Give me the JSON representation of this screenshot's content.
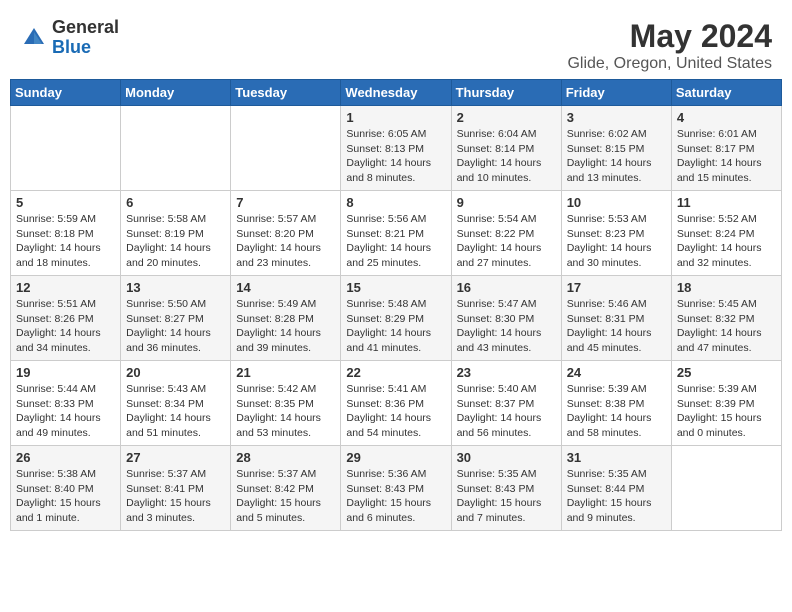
{
  "header": {
    "logo_general": "General",
    "logo_blue": "Blue",
    "month_title": "May 2024",
    "location": "Glide, Oregon, United States"
  },
  "weekdays": [
    "Sunday",
    "Monday",
    "Tuesday",
    "Wednesday",
    "Thursday",
    "Friday",
    "Saturday"
  ],
  "weeks": [
    [
      {
        "day": "",
        "info": ""
      },
      {
        "day": "",
        "info": ""
      },
      {
        "day": "",
        "info": ""
      },
      {
        "day": "1",
        "info": "Sunrise: 6:05 AM\nSunset: 8:13 PM\nDaylight: 14 hours\nand 8 minutes."
      },
      {
        "day": "2",
        "info": "Sunrise: 6:04 AM\nSunset: 8:14 PM\nDaylight: 14 hours\nand 10 minutes."
      },
      {
        "day": "3",
        "info": "Sunrise: 6:02 AM\nSunset: 8:15 PM\nDaylight: 14 hours\nand 13 minutes."
      },
      {
        "day": "4",
        "info": "Sunrise: 6:01 AM\nSunset: 8:17 PM\nDaylight: 14 hours\nand 15 minutes."
      }
    ],
    [
      {
        "day": "5",
        "info": "Sunrise: 5:59 AM\nSunset: 8:18 PM\nDaylight: 14 hours\nand 18 minutes."
      },
      {
        "day": "6",
        "info": "Sunrise: 5:58 AM\nSunset: 8:19 PM\nDaylight: 14 hours\nand 20 minutes."
      },
      {
        "day": "7",
        "info": "Sunrise: 5:57 AM\nSunset: 8:20 PM\nDaylight: 14 hours\nand 23 minutes."
      },
      {
        "day": "8",
        "info": "Sunrise: 5:56 AM\nSunset: 8:21 PM\nDaylight: 14 hours\nand 25 minutes."
      },
      {
        "day": "9",
        "info": "Sunrise: 5:54 AM\nSunset: 8:22 PM\nDaylight: 14 hours\nand 27 minutes."
      },
      {
        "day": "10",
        "info": "Sunrise: 5:53 AM\nSunset: 8:23 PM\nDaylight: 14 hours\nand 30 minutes."
      },
      {
        "day": "11",
        "info": "Sunrise: 5:52 AM\nSunset: 8:24 PM\nDaylight: 14 hours\nand 32 minutes."
      }
    ],
    [
      {
        "day": "12",
        "info": "Sunrise: 5:51 AM\nSunset: 8:26 PM\nDaylight: 14 hours\nand 34 minutes."
      },
      {
        "day": "13",
        "info": "Sunrise: 5:50 AM\nSunset: 8:27 PM\nDaylight: 14 hours\nand 36 minutes."
      },
      {
        "day": "14",
        "info": "Sunrise: 5:49 AM\nSunset: 8:28 PM\nDaylight: 14 hours\nand 39 minutes."
      },
      {
        "day": "15",
        "info": "Sunrise: 5:48 AM\nSunset: 8:29 PM\nDaylight: 14 hours\nand 41 minutes."
      },
      {
        "day": "16",
        "info": "Sunrise: 5:47 AM\nSunset: 8:30 PM\nDaylight: 14 hours\nand 43 minutes."
      },
      {
        "day": "17",
        "info": "Sunrise: 5:46 AM\nSunset: 8:31 PM\nDaylight: 14 hours\nand 45 minutes."
      },
      {
        "day": "18",
        "info": "Sunrise: 5:45 AM\nSunset: 8:32 PM\nDaylight: 14 hours\nand 47 minutes."
      }
    ],
    [
      {
        "day": "19",
        "info": "Sunrise: 5:44 AM\nSunset: 8:33 PM\nDaylight: 14 hours\nand 49 minutes."
      },
      {
        "day": "20",
        "info": "Sunrise: 5:43 AM\nSunset: 8:34 PM\nDaylight: 14 hours\nand 51 minutes."
      },
      {
        "day": "21",
        "info": "Sunrise: 5:42 AM\nSunset: 8:35 PM\nDaylight: 14 hours\nand 53 minutes."
      },
      {
        "day": "22",
        "info": "Sunrise: 5:41 AM\nSunset: 8:36 PM\nDaylight: 14 hours\nand 54 minutes."
      },
      {
        "day": "23",
        "info": "Sunrise: 5:40 AM\nSunset: 8:37 PM\nDaylight: 14 hours\nand 56 minutes."
      },
      {
        "day": "24",
        "info": "Sunrise: 5:39 AM\nSunset: 8:38 PM\nDaylight: 14 hours\nand 58 minutes."
      },
      {
        "day": "25",
        "info": "Sunrise: 5:39 AM\nSunset: 8:39 PM\nDaylight: 15 hours\nand 0 minutes."
      }
    ],
    [
      {
        "day": "26",
        "info": "Sunrise: 5:38 AM\nSunset: 8:40 PM\nDaylight: 15 hours\nand 1 minute."
      },
      {
        "day": "27",
        "info": "Sunrise: 5:37 AM\nSunset: 8:41 PM\nDaylight: 15 hours\nand 3 minutes."
      },
      {
        "day": "28",
        "info": "Sunrise: 5:37 AM\nSunset: 8:42 PM\nDaylight: 15 hours\nand 5 minutes."
      },
      {
        "day": "29",
        "info": "Sunrise: 5:36 AM\nSunset: 8:43 PM\nDaylight: 15 hours\nand 6 minutes."
      },
      {
        "day": "30",
        "info": "Sunrise: 5:35 AM\nSunset: 8:43 PM\nDaylight: 15 hours\nand 7 minutes."
      },
      {
        "day": "31",
        "info": "Sunrise: 5:35 AM\nSunset: 8:44 PM\nDaylight: 15 hours\nand 9 minutes."
      },
      {
        "day": "",
        "info": ""
      }
    ]
  ]
}
